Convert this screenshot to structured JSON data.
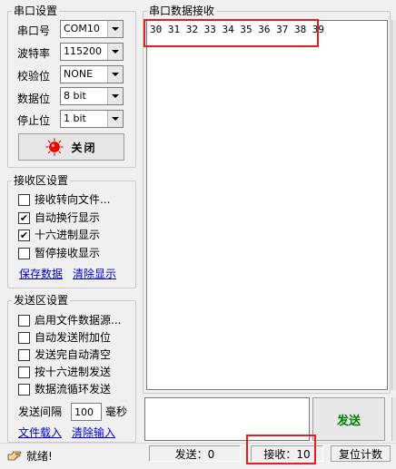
{
  "serial_settings": {
    "title": "串口设置",
    "port_label": "串口号",
    "port_value": "COM10",
    "baud_label": "波特率",
    "baud_value": "115200",
    "parity_label": "校验位",
    "parity_value": "NONE",
    "databits_label": "数据位",
    "databits_value": "8 bit",
    "stopbits_label": "停止位",
    "stopbits_value": "1 bit",
    "close_button_label": "关闭",
    "status_light_color": "#ff0000"
  },
  "receive_settings": {
    "title": "接收区设置",
    "options": [
      {
        "label": "接收转向文件...",
        "checked": false
      },
      {
        "label": "自动换行显示",
        "checked": true
      },
      {
        "label": "十六进制显示",
        "checked": true
      },
      {
        "label": "暂停接收显示",
        "checked": false
      }
    ],
    "save_link": "保存数据",
    "clear_link": "清除显示"
  },
  "send_settings": {
    "title": "发送区设置",
    "options": [
      {
        "label": "启用文件数据源...",
        "checked": false
      },
      {
        "label": "自动发送附加位",
        "checked": false
      },
      {
        "label": "发送完自动清空",
        "checked": false
      },
      {
        "label": "按十六进制发送",
        "checked": false
      },
      {
        "label": "数据流循环发送",
        "checked": false
      }
    ],
    "interval_label": "发送间隔",
    "interval_value": "100",
    "interval_unit": "毫秒",
    "load_file_link": "文件载入",
    "clear_input_link": "清除输入"
  },
  "receive_area": {
    "title": "串口数据接收",
    "content": "30 31 32 33 34 35 36 37 38 39"
  },
  "send_area": {
    "content": "",
    "send_button_label": "发送"
  },
  "status_bar": {
    "ready_text": "就绪!",
    "sent_text": "发送：0",
    "received_text": "接收：10",
    "reset_label": "复位计数"
  },
  "colors": {
    "highlight_box": "#e02020",
    "send_button_text": "#008000",
    "link": "#0000cc"
  }
}
